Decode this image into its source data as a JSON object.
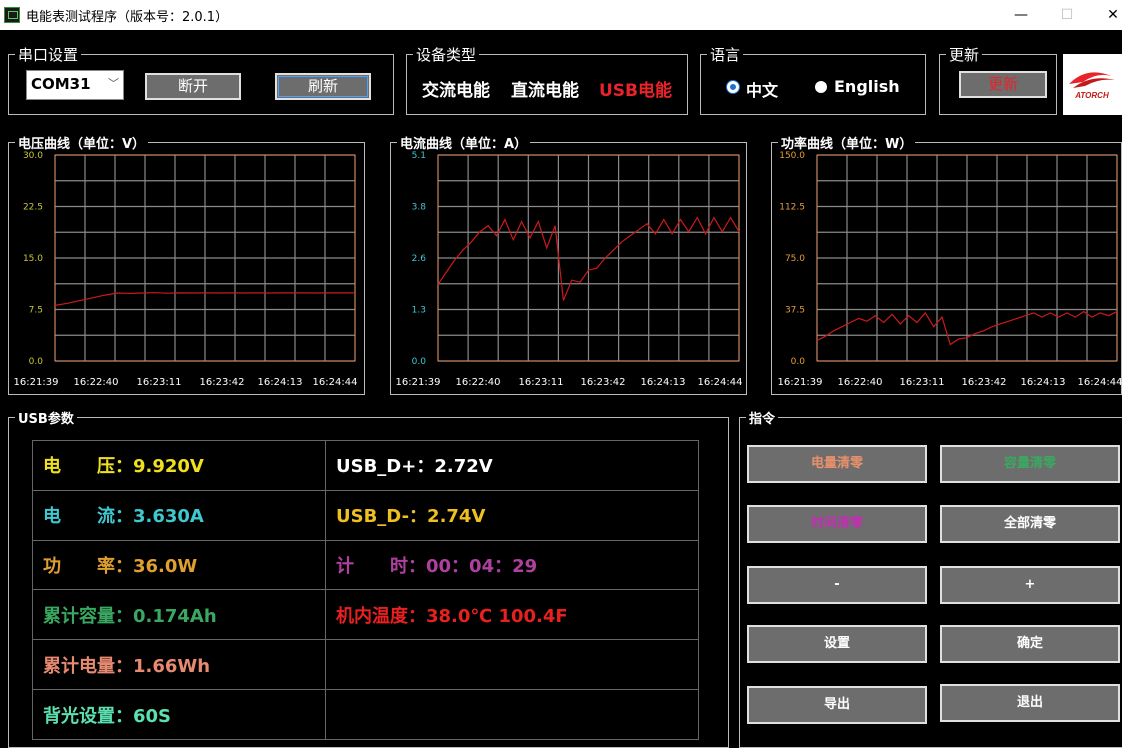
{
  "window": {
    "title": "电能表测试程序（版本号：2.0.1）",
    "minimize": "—",
    "maximize": "☐",
    "close": "✕"
  },
  "serial": {
    "legend": "串口设置",
    "port": "COM31",
    "disconnect_label": "断开",
    "refresh_label": "刷新"
  },
  "device_type": {
    "legend": "设备类型",
    "ac": "交流电能",
    "dc": "直流电能",
    "usb": "USB电能",
    "selected": "usb"
  },
  "language": {
    "legend": "语言",
    "zh": "中文",
    "en": "English",
    "selected": "zh"
  },
  "update": {
    "legend": "更新",
    "button_label": "更新"
  },
  "logo": {
    "text": "ATORCH"
  },
  "colors": {
    "accent_red": "#e8232a",
    "grid": "#8a8a8a",
    "plot_border": "#d4895a",
    "voltage_axis": "#c8c833",
    "current_axis": "#40c8d0",
    "power_axis": "#e0a030",
    "trace": "#cc1a1a"
  },
  "chart_data": [
    {
      "type": "line",
      "title": "电压曲线（单位：V）",
      "yticks": [
        "30.0",
        "22.5",
        "15.0",
        "7.5",
        "0.0"
      ],
      "ylim": [
        0,
        30
      ],
      "xticks": [
        "16:21:39",
        "16:22:40",
        "16:23:11",
        "16:23:42",
        "16:24:13",
        "16:24:44"
      ],
      "grid": true,
      "series": [
        {
          "values": [
            8.1,
            8.4,
            8.8,
            9.2,
            9.6,
            9.9,
            9.85,
            9.9,
            9.95,
            9.88,
            9.92,
            9.9,
            9.92,
            9.9,
            9.92,
            9.91,
            9.92,
            9.9,
            9.92,
            9.92,
            9.92,
            9.9,
            9.92,
            9.92,
            9.92
          ]
        }
      ]
    },
    {
      "type": "line",
      "title": "电流曲线（单位：A）",
      "yticks": [
        "5.1",
        "3.8",
        "2.6",
        "1.3",
        "0.0"
      ],
      "ylim": [
        0,
        5.1
      ],
      "xticks": [
        "16:21:39",
        "16:22:40",
        "16:23:11",
        "16:23:42",
        "16:24:13",
        "16:24:44"
      ],
      "grid": true,
      "series": [
        {
          "values": [
            1.9,
            2.2,
            2.5,
            2.75,
            2.95,
            3.2,
            3.35,
            3.1,
            3.5,
            3.0,
            3.45,
            3.05,
            3.45,
            2.8,
            3.35,
            1.5,
            2.0,
            1.95,
            2.25,
            2.3,
            2.55,
            2.75,
            2.95,
            3.1,
            3.25,
            3.4,
            3.15,
            3.5,
            3.15,
            3.5,
            3.2,
            3.55,
            3.15,
            3.55,
            3.2,
            3.55,
            3.2
          ]
        }
      ]
    },
    {
      "type": "line",
      "title": "功率曲线（单位：W）",
      "yticks": [
        "150.0",
        "112.5",
        "75.0",
        "37.5",
        "0.0"
      ],
      "ylim": [
        0,
        150
      ],
      "xticks": [
        "16:21:39",
        "16:22:40",
        "16:23:11",
        "16:23:42",
        "16:24:13",
        "16:24:44"
      ],
      "grid": true,
      "series": [
        {
          "values": [
            15,
            18,
            22,
            25,
            28,
            31,
            29,
            33,
            28,
            34,
            27,
            33,
            28,
            35,
            25,
            32,
            12,
            16,
            17,
            20,
            22,
            25,
            27,
            29,
            31,
            33,
            35,
            32,
            35,
            32,
            35,
            32,
            36,
            32,
            35,
            33,
            36
          ]
        }
      ]
    }
  ],
  "usb_params": {
    "legend": "USB参数",
    "voltage": {
      "label": "电　　压：",
      "value": "9.920V",
      "color": "#f0e020"
    },
    "current": {
      "label": "电　　流：",
      "value": "3.630A",
      "color": "#40c8d0"
    },
    "power": {
      "label": "功　　率：",
      "value": "36.0W",
      "color": "#e0a030"
    },
    "capacity": {
      "label": "累计容量：",
      "value": "0.174Ah",
      "color": "#3aa860"
    },
    "energy": {
      "label": "累计电量：",
      "value": "1.66Wh",
      "color": "#e88a70"
    },
    "backlight": {
      "label": "背光设置：",
      "value": "60S",
      "color": "#5ce0b0"
    },
    "d_plus": {
      "label": "USB_D+：",
      "value": "2.72V",
      "color": "#ffffff"
    },
    "d_minus": {
      "label": "USB_D-：",
      "value": "2.74V",
      "color": "#f0c020"
    },
    "timer": {
      "label": "计　　时：",
      "value": "00：04：29",
      "color": "#b040a0"
    },
    "temperature": {
      "label": "机内温度：",
      "value": "38.0℃ 100.4F",
      "color": "#e82020"
    }
  },
  "commands": {
    "legend": "指令",
    "clear_energy": "电量清零",
    "clear_capacity": "容量清零",
    "clear_time": "时间清零",
    "clear_all": "全部清零",
    "minus": "-",
    "plus": "+",
    "settings": "设置",
    "confirm": "确定",
    "export": "导出",
    "exit": "退出"
  }
}
